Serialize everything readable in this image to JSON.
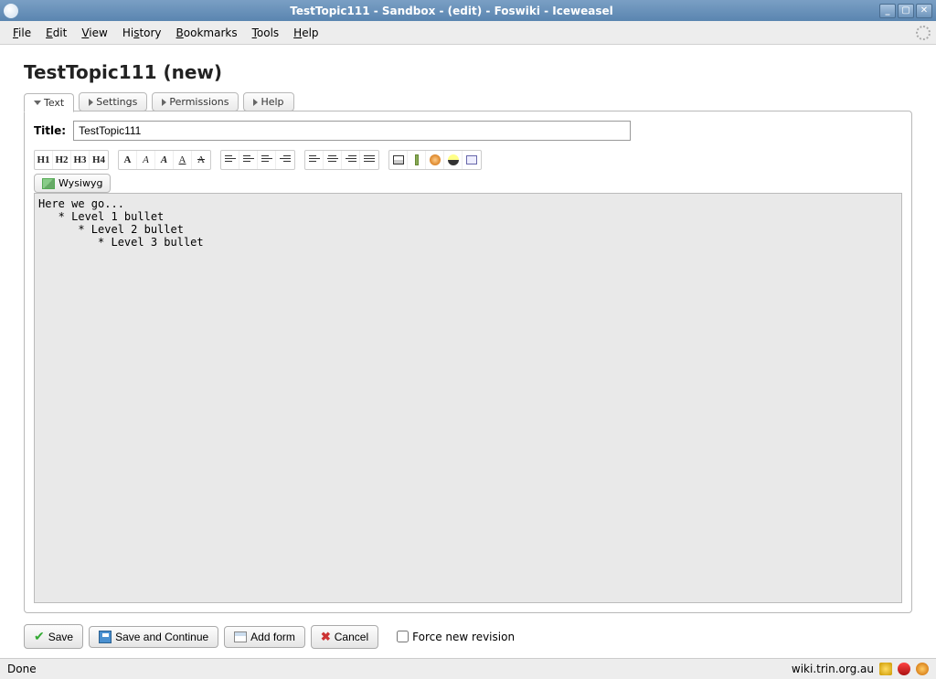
{
  "window": {
    "title": "TestTopic111 - Sandbox - (edit) - Foswiki - Iceweasel"
  },
  "menubar": [
    "File",
    "Edit",
    "View",
    "History",
    "Bookmarks",
    "Tools",
    "Help"
  ],
  "page": {
    "heading": "TestTopic111 (new)"
  },
  "tabs": {
    "text": "Text",
    "settings": "Settings",
    "permissions": "Permissions",
    "help": "Help"
  },
  "title_field": {
    "label": "Title:",
    "value": "TestTopic111"
  },
  "heading_buttons": [
    "H1",
    "H2",
    "H3",
    "H4"
  ],
  "wysiwyg_label": "Wysiwyg",
  "editor_content": "Here we go...\n   * Level 1 bullet\n      * Level 2 bullet\n         * Level 3 bullet",
  "actions": {
    "save": "Save",
    "save_continue": "Save and Continue",
    "add_form": "Add form",
    "cancel": "Cancel",
    "force_new_revision": "Force new revision"
  },
  "statusbar": {
    "left": "Done",
    "right": "wiki.trin.org.au"
  }
}
